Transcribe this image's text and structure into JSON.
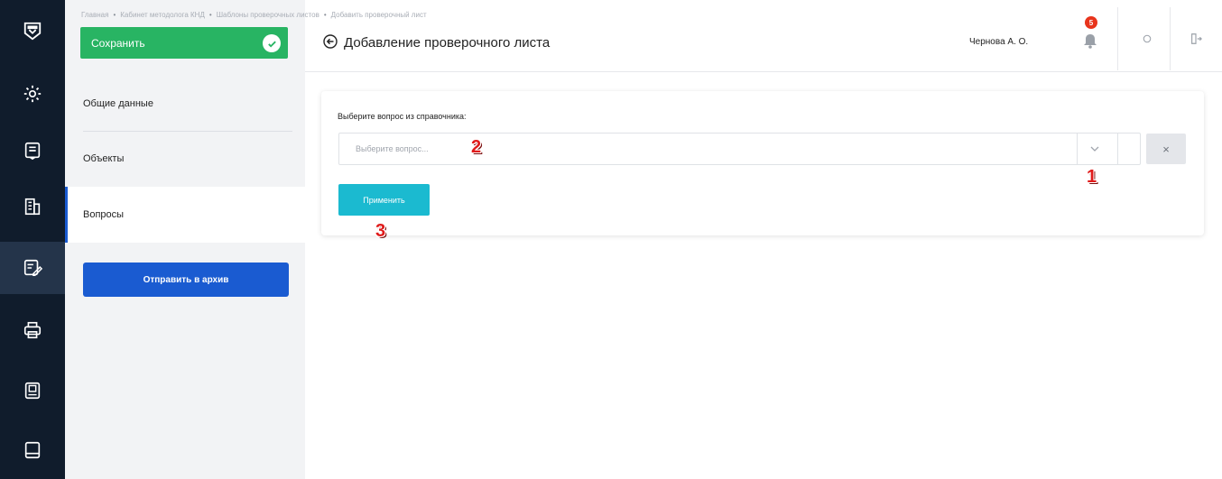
{
  "breadcrumb": {
    "items": [
      "Главная",
      "Кабинет методолога КНД",
      "Шаблоны проверочных листов",
      "Добавить проверочный лист"
    ],
    "separator": "•"
  },
  "save_button": {
    "label": "Сохранить",
    "icon": "check-circle-icon"
  },
  "sidebar": {
    "items": [
      {
        "label": "Общие данные",
        "active": false
      },
      {
        "label": "Объекты",
        "active": false
      },
      {
        "label": "Вопросы",
        "active": true
      }
    ],
    "archive_button": "Отправить в архив"
  },
  "rail": {
    "icons": [
      "logo-shield-icon",
      "gear-icon",
      "document-list-icon",
      "building-icon",
      "edit-checklist-icon",
      "printer-icon",
      "archive-box-icon",
      "book-icon"
    ],
    "active_index": 4
  },
  "header": {
    "title": "Добавление проверочного листа",
    "user_name": "Чернова А. О.",
    "notification_count": "5"
  },
  "form": {
    "label": "Выберите вопрос из справочника:",
    "select_placeholder": "Выберите вопрос...",
    "clear_symbol": "×",
    "apply_button": "Применить"
  },
  "annotations": [
    "1",
    "2",
    "3"
  ],
  "colors": {
    "rail_bg": "#101c2c",
    "save_green": "#28b463",
    "archive_blue": "#1a5bd1",
    "apply_cyan": "#1bbad0",
    "badge_red": "#e8341c",
    "marker_red": "#e01b1b"
  }
}
